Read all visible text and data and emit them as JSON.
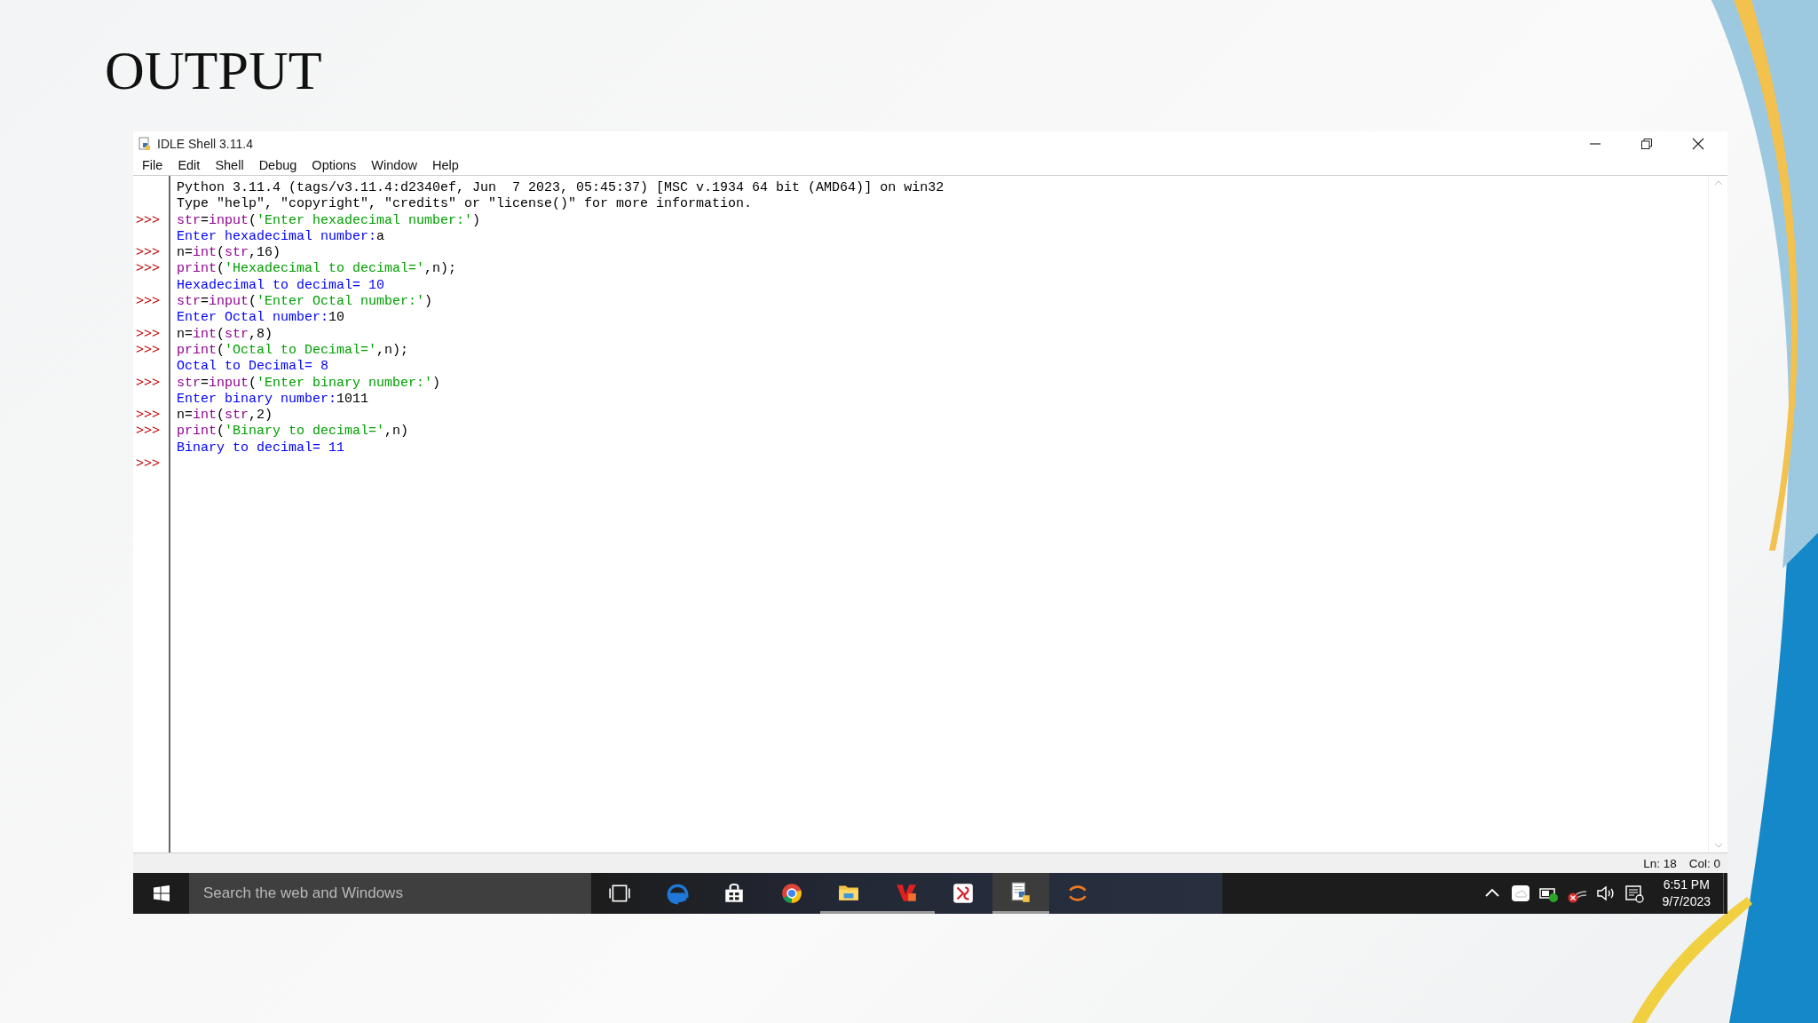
{
  "slide": {
    "title": "OUTPUT"
  },
  "window": {
    "title": "IDLE Shell 3.11.4"
  },
  "menu": [
    "File",
    "Edit",
    "Shell",
    "Debug",
    "Options",
    "Window",
    "Help"
  ],
  "shell": {
    "lines": [
      {
        "segments": [
          {
            "kind": "plain",
            "text": "Python 3.11.4 (tags/v3.11.4:d2340ef, Jun  7 2023, 05:45:37) [MSC v.1934 64 bit (AMD64)] on win32"
          }
        ]
      },
      {
        "segments": [
          {
            "kind": "plain",
            "text": "Type \"help\", \"copyright\", \"credits\" or \"license()\" for more information."
          }
        ]
      },
      {
        "prompt": ">>>",
        "segments": [
          {
            "kind": "builtin",
            "text": "str"
          },
          {
            "kind": "plain",
            "text": "="
          },
          {
            "kind": "builtin",
            "text": "input"
          },
          {
            "kind": "plain",
            "text": "("
          },
          {
            "kind": "string",
            "text": "'Enter hexadecimal number:'"
          },
          {
            "kind": "plain",
            "text": ")"
          }
        ]
      },
      {
        "segments": [
          {
            "kind": "stdout",
            "text": "Enter hexadecimal number:"
          },
          {
            "kind": "plain",
            "text": "a"
          }
        ]
      },
      {
        "prompt": ">>>",
        "segments": [
          {
            "kind": "plain",
            "text": "n="
          },
          {
            "kind": "builtin",
            "text": "int"
          },
          {
            "kind": "plain",
            "text": "("
          },
          {
            "kind": "builtin",
            "text": "str"
          },
          {
            "kind": "plain",
            "text": ",16)"
          }
        ]
      },
      {
        "prompt": ">>>",
        "segments": [
          {
            "kind": "builtin",
            "text": "print"
          },
          {
            "kind": "plain",
            "text": "("
          },
          {
            "kind": "string",
            "text": "'Hexadecimal to decimal='"
          },
          {
            "kind": "plain",
            "text": ",n);"
          }
        ]
      },
      {
        "segments": [
          {
            "kind": "stdout",
            "text": "Hexadecimal to decimal= 10"
          }
        ]
      },
      {
        "prompt": ">>>",
        "segments": [
          {
            "kind": "builtin",
            "text": "str"
          },
          {
            "kind": "plain",
            "text": "="
          },
          {
            "kind": "builtin",
            "text": "input"
          },
          {
            "kind": "plain",
            "text": "("
          },
          {
            "kind": "string",
            "text": "'Enter Octal number:'"
          },
          {
            "kind": "plain",
            "text": ")"
          }
        ]
      },
      {
        "segments": [
          {
            "kind": "stdout",
            "text": "Enter Octal number:"
          },
          {
            "kind": "plain",
            "text": "10"
          }
        ]
      },
      {
        "prompt": ">>>",
        "segments": [
          {
            "kind": "plain",
            "text": "n="
          },
          {
            "kind": "builtin",
            "text": "int"
          },
          {
            "kind": "plain",
            "text": "("
          },
          {
            "kind": "builtin",
            "text": "str"
          },
          {
            "kind": "plain",
            "text": ",8)"
          }
        ]
      },
      {
        "prompt": ">>>",
        "segments": [
          {
            "kind": "builtin",
            "text": "print"
          },
          {
            "kind": "plain",
            "text": "("
          },
          {
            "kind": "string",
            "text": "'Octal to Decimal='"
          },
          {
            "kind": "plain",
            "text": ",n);"
          }
        ]
      },
      {
        "segments": [
          {
            "kind": "stdout",
            "text": "Octal to Decimal= 8"
          }
        ]
      },
      {
        "prompt": ">>>",
        "segments": [
          {
            "kind": "builtin",
            "text": "str"
          },
          {
            "kind": "plain",
            "text": "="
          },
          {
            "kind": "builtin",
            "text": "input"
          },
          {
            "kind": "plain",
            "text": "("
          },
          {
            "kind": "string",
            "text": "'Enter binary number:'"
          },
          {
            "kind": "plain",
            "text": ")"
          }
        ]
      },
      {
        "segments": [
          {
            "kind": "stdout",
            "text": "Enter binary number:"
          },
          {
            "kind": "plain",
            "text": "1011"
          }
        ]
      },
      {
        "prompt": ">>>",
        "segments": [
          {
            "kind": "plain",
            "text": "n="
          },
          {
            "kind": "builtin",
            "text": "int"
          },
          {
            "kind": "plain",
            "text": "("
          },
          {
            "kind": "builtin",
            "text": "str"
          },
          {
            "kind": "plain",
            "text": ",2)"
          }
        ]
      },
      {
        "prompt": ">>>",
        "segments": [
          {
            "kind": "builtin",
            "text": "print"
          },
          {
            "kind": "plain",
            "text": "("
          },
          {
            "kind": "string",
            "text": "'Binary to decimal='"
          },
          {
            "kind": "plain",
            "text": ",n)"
          }
        ]
      },
      {
        "segments": [
          {
            "kind": "stdout",
            "text": "Binary to decimal= 11"
          }
        ]
      },
      {
        "prompt": ">>>"
      }
    ]
  },
  "status_bar": {
    "line": "Ln: 18",
    "column": "Col: 0"
  },
  "taskbar": {
    "search": {
      "placeholder": "Search the web and Windows"
    },
    "apps": [
      {
        "kind": "taskview",
        "running": false,
        "selected": false
      },
      {
        "kind": "edge",
        "running": false,
        "selected": false
      },
      {
        "kind": "store",
        "running": false,
        "selected": false
      },
      {
        "kind": "chrome",
        "running": false,
        "selected": false
      },
      {
        "kind": "explorer",
        "running": true,
        "selected": false
      },
      {
        "kind": "redapp",
        "running": true,
        "selected": false
      },
      {
        "kind": "xsapp",
        "running": false,
        "selected": false
      },
      {
        "kind": "python",
        "running": true,
        "selected": true
      },
      {
        "kind": "orangeapp",
        "running": false,
        "selected": false
      }
    ],
    "tray": [
      {
        "kind": "caret"
      },
      {
        "kind": "cloud"
      },
      {
        "kind": "battery"
      },
      {
        "kind": "network"
      },
      {
        "kind": "volume"
      },
      {
        "kind": "notifications"
      }
    ],
    "clock": {
      "time": "6:51 PM",
      "date": "9/7/2023"
    }
  }
}
